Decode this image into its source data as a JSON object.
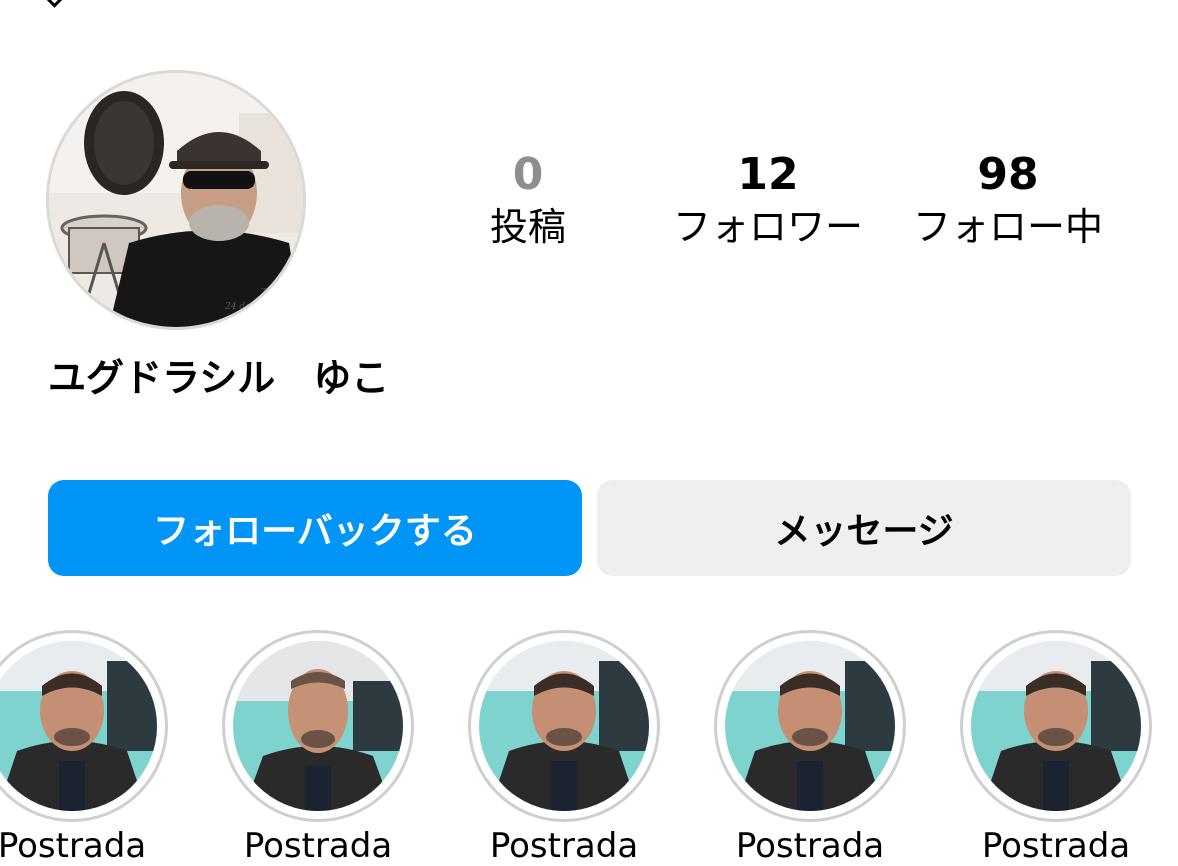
{
  "profile": {
    "name": "ユグドラシル　ゆこ",
    "avatar_icon": "profile-photo-drummer",
    "avatar_caption_line1": "Tomad",
    "avatar_caption_line2": "24 de septi"
  },
  "stats": [
    {
      "count": "0",
      "label": "投稿"
    },
    {
      "count": "12",
      "label": "フォロワー"
    },
    {
      "count": "98",
      "label": "フォロー中"
    }
  ],
  "actions": {
    "follow_back_label": "フォローバックする",
    "message_label": "メッセージ"
  },
  "highlights": [
    {
      "label": "Postrada",
      "icon": "highlight-photo"
    },
    {
      "label": "Postrada",
      "icon": "highlight-photo"
    },
    {
      "label": "Postrada",
      "icon": "highlight-photo"
    },
    {
      "label": "Postrada",
      "icon": "highlight-photo"
    },
    {
      "label": "Postrada",
      "icon": "highlight-photo"
    }
  ],
  "colors": {
    "accent": "#0095f6",
    "secondary_button": "#efefef",
    "muted_text": "#8e8e8e"
  }
}
